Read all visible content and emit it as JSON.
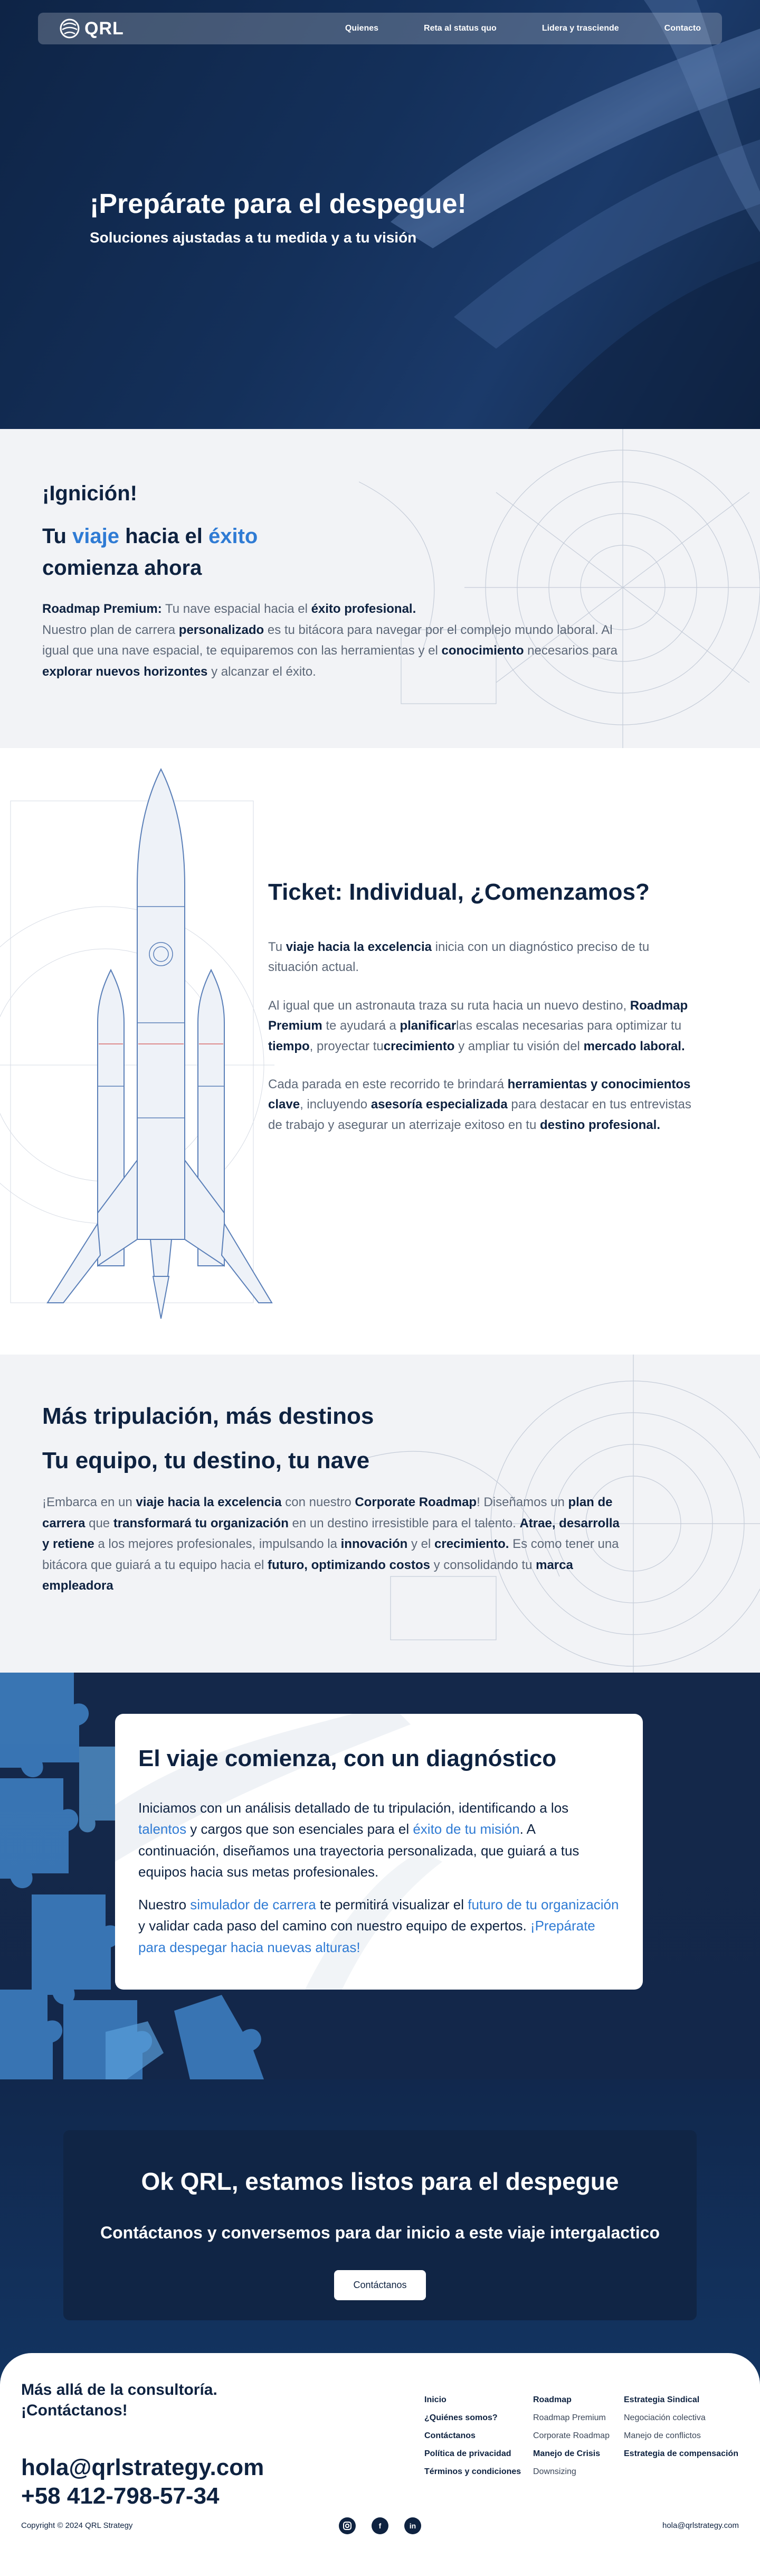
{
  "nav": {
    "logo_text": "QRL",
    "links": [
      "Quienes",
      "Reta al status quo",
      "Lidera y trasciende",
      "Contacto"
    ]
  },
  "hero": {
    "title": "¡Prepárate para el despegue!",
    "subtitle": "Soluciones ajustadas a tu medida y a tu visión"
  },
  "ignition": {
    "eyebrow": "¡Ignición!",
    "headline_1": "Tu ",
    "headline_2": "viaje",
    "headline_3": " hacia el ",
    "headline_4": "éxito",
    "headline_5": "comienza ahora",
    "p_b1": "Roadmap Premium:",
    "p_1": " Tu nave espacial hacia el ",
    "p_b2": "éxito profesional.",
    "p_2": "Nuestro plan de carrera ",
    "p_b3": "personalizado",
    "p_3": " es tu bitácora para navegar por el complejo mundo laboral. Al igual que una nave espacial, te equiparemos con las herramientas y el ",
    "p_b4": "conocimiento",
    "p_4": " necesarios para ",
    "p_b5": "explorar nuevos horizontes",
    "p_5": " y alcanzar el éxito."
  },
  "ticket": {
    "title": "Ticket: Individual, ¿Comenzamos?",
    "p1_a": "Tu ",
    "p1_b": "viaje hacia la excelencia",
    "p1_c": " inicia con un diagnóstico preciso de tu situación actual.",
    "p2_a": "Al igual que un astronauta traza su ruta hacia un nuevo destino, ",
    "p2_b": "Roadmap Premium",
    "p2_c": " te ayudará a ",
    "p2_d": "planificar",
    "p2_e": "las escalas necesarias para optimizar tu ",
    "p2_f": "tiempo",
    "p2_g": ", proyectar tu",
    "p2_h": "crecimiento",
    "p2_i": " y ampliar tu visión del ",
    "p2_j": "mercado laboral.",
    "p3_a": "Cada parada en este recorrido te brindará ",
    "p3_b": "herramientas y conocimientos clave",
    "p3_c": ", incluyendo ",
    "p3_d": "asesoría especializada",
    "p3_e": " para destacar en tus entrevistas de trabajo y asegurar un aterrizaje exitoso en tu ",
    "p3_f": "destino profesional."
  },
  "crew": {
    "title_1": "Más tripulación, más destinos",
    "title_2": "Tu equipo, tu destino, tu nave",
    "a": "¡Embarca en un ",
    "b": "viaje hacia la excelencia",
    "c": " con nuestro ",
    "d": "Corporate Roadmap",
    "e": "! Diseñamos un ",
    "f": "plan de carrera",
    "g": " que ",
    "h": "transformará tu organización",
    "i": " en un destino irresistible para el talento. ",
    "j": "Atrae, desarrolla y retiene",
    "k": " a los mejores profesionales, impulsando la ",
    "l": "innovación",
    "m": " y el ",
    "n": "crecimiento.",
    "o": " Es como tener una bitácora que guiará a tu equipo hacia el ",
    "p": "futuro, optimizando costos",
    "q": " y consolidando tu ",
    "r": "marca empleadora"
  },
  "diagnostic": {
    "title": "El viaje comienza, con un diagnóstico",
    "p1_a": "Iniciamos con un análisis detallado de tu tripulación, identificando a los ",
    "p1_b": "talentos",
    "p1_c": " y cargos que son esenciales para el ",
    "p1_d": "éxito de tu misión",
    "p1_e": ". A continuación, diseñamos una trayectoria personalizada, que guiará a tus equipos hacia sus metas profesionales.",
    "p2_a": "Nuestro ",
    "p2_b": "simulador de carrera",
    "p2_c": " te permitirá visualizar el ",
    "p2_d": "futuro de tu organización",
    "p2_e": " y validar cada paso del camino con nuestro equipo de expertos. ",
    "p2_f": "¡Prepárate para despegar hacia nuevas alturas!"
  },
  "cta": {
    "title": "Ok QRL, estamos listos para el despegue",
    "subtitle": "Contáctanos y conversemos para dar inicio a este viaje intergalactico",
    "button": "Contáctanos"
  },
  "footer": {
    "tagline_1": "Más allá de la consultoría.",
    "tagline_2": "¡Contáctanos!",
    "email": "hola@qrlstrategy.com",
    "phone": "+58 412-798-57-34",
    "col1": [
      "Inicio",
      "¿Quiénes somos?",
      "Contáctanos",
      "Política de privacidad",
      "Términos y condiciones"
    ],
    "col2_head": "Roadmap",
    "col2": [
      "Roadmap Premium",
      "Corporate Roadmap",
      "Manejo de Crisis",
      "Downsizing"
    ],
    "col3_head": "Estrategia Sindical",
    "col3": [
      "Negociación colectiva",
      "Manejo de conflictos",
      "Estrategia de compensación"
    ],
    "copyright": "Copyright © 2024 QRL Strategy",
    "mail_small": "hola@qrlstrategy.com",
    "social": [
      "instagram-icon",
      "facebook-icon",
      "linkedin-icon"
    ]
  },
  "colors": {
    "navy": "#0e2240",
    "accent": "#2f7bd4",
    "muted": "#5d6878",
    "puzzle": "#4a8fcf"
  }
}
